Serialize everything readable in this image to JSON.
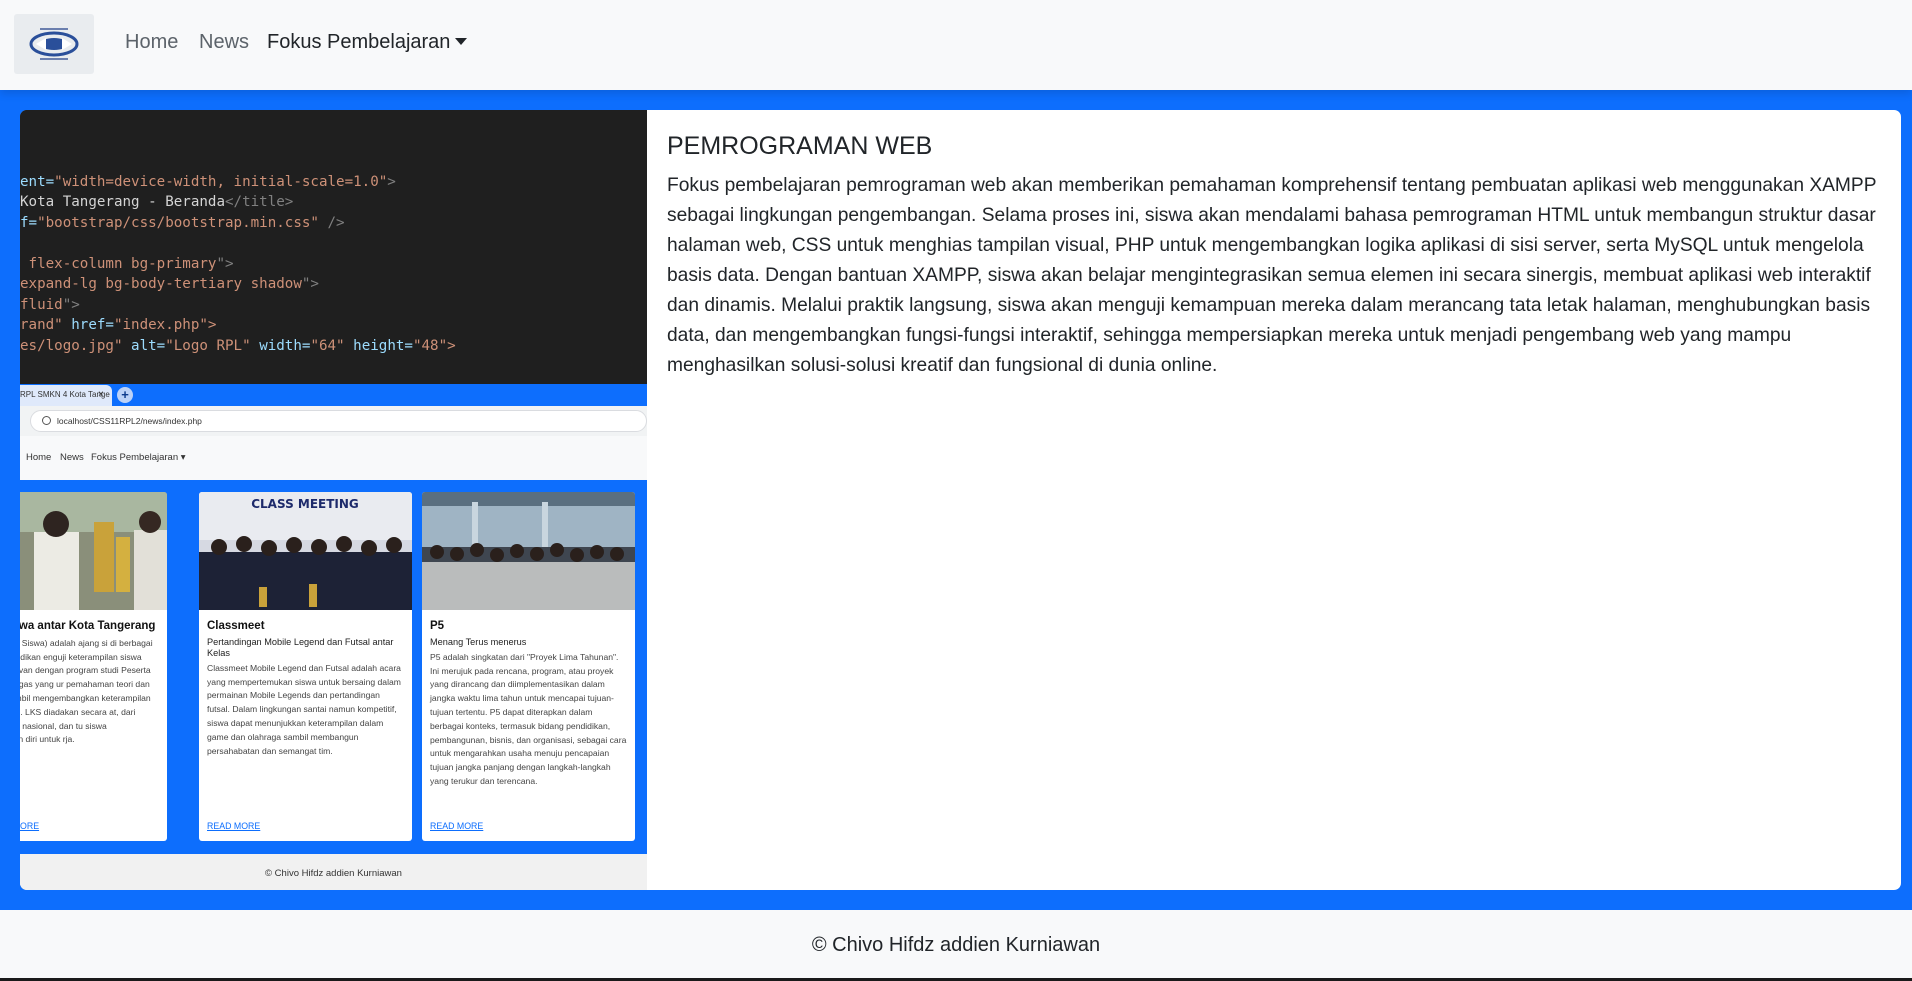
{
  "navbar": {
    "logo_alt": "Logo RPL",
    "links": [
      {
        "label": "Home"
      },
      {
        "label": "News"
      },
      {
        "label": "Fokus Pembelajaran"
      }
    ]
  },
  "main": {
    "card": {
      "title": "PEMROGRAMAN WEB",
      "text": "Fokus pembelajaran pemrograman web akan memberikan pemahaman komprehensif tentang pembuatan aplikasi web menggunakan XAMPP sebagai lingkungan pengembangan. Selama proses ini, siswa akan mendalami bahasa pemrograman HTML untuk membangun struktur dasar halaman web, CSS untuk menghias tampilan visual, PHP untuk mengembangkan logika aplikasi di sisi server, serta MySQL untuk mengelola basis data. Dengan bantuan XAMPP, siswa akan belajar mengintegrasikan semua elemen ini secara sinergis, membuat aplikasi web interaktif dan dinamis. Melalui praktik langsung, siswa akan menguji kemampuan mereka dalam merancang tata letak halaman, menghubungkan basis data, dan mengembangkan fungsi-fungsi interaktif, sehingga mempersiapkan mereka untuk menjadi pengembang web yang mampu menghasilkan solusi-solusi kreatif dan fungsional di dunia online."
    },
    "image": {
      "code_lines": [
        [
          "ent=",
          "\"width=device-width, initial-scale=1.0\"",
          ">"
        ],
        [
          "Kota Tangerang - Beranda",
          "</title>",
          ""
        ],
        [
          "f=",
          "\"bootstrap/css/bootstrap.min.css\"",
          " />"
        ],
        [
          "",
          "",
          ""
        ],
        [
          " flex-column bg-primary",
          "\">",
          ""
        ],
        [
          "expand-lg bg-body-tertiary shadow",
          "\">",
          ""
        ],
        [
          "fluid",
          "\">",
          ""
        ],
        [
          "rand\" ",
          "href=",
          "\"index.php\">"
        ],
        [
          "es/logo.jpg\" ",
          "alt=",
          "\"Logo RPL\" "
        ]
      ],
      "code_tail": [
        "width=",
        "\"64\" ",
        "height=",
        "\"48\">"
      ],
      "tab_label": "RPL SMKN 4 Kota Tange",
      "tab_close": "×",
      "new_tab": "+",
      "address": "localhost/CSS11RPL2/news/index.php",
      "mini_nav": [
        "Home",
        "News",
        "Fokus Pembelajaran ▾"
      ],
      "cards": [
        {
          "title": "Kreatif Siswa antar Kota Tangerang",
          "subtitle": "",
          "text": "ba Kompetensi Siswa) adalah ajang si di berbagai tingkatan pendidikan enguji keterampilan siswa dalam ang relevan dengan program studi Peserta menghadapi tugas yang ur pemahaman teori dan penerapan sambil mengembangkan keterampilan tif dan kerja tim. LKS diadakan secara at, dari sekolah hingga nasional, dan tu siswa mempersiapkan diri untuk rja.",
          "more": "ORE"
        },
        {
          "title": "Classmeet",
          "subtitle": "Pertandingan Mobile Legend dan Futsal antar Kelas",
          "text": "Classmeet Mobile Legend dan Futsal adalah acara yang mempertemukan siswa untuk bersaing dalam permainan Mobile Legends dan pertandingan futsal. Dalam lingkungan santai namun kompetitif, siswa dapat menunjukkan keterampilan dalam game dan olahraga sambil membangun persahabatan dan semangat tim.",
          "more": "READ MORE",
          "banner": "CLASS MEETING"
        },
        {
          "title": "P5",
          "subtitle": "Menang Terus menerus",
          "text": "P5 adalah singkatan dari \"Proyek Lima Tahunan\". Ini merujuk pada rencana, program, atau proyek yang dirancang dan diimplementasikan dalam jangka waktu lima tahun untuk mencapai tujuan-tujuan tertentu. P5 dapat diterapkan dalam berbagai konteks, termasuk bidang pendidikan, pembangunan, bisnis, dan organisasi, sebagai cara untuk mengarahkan usaha menuju pencapaian tujuan jangka panjang dengan langkah-langkah yang terukur dan terencana.",
          "more": "READ MORE"
        }
      ],
      "footer": "© Chivo Hifdz addien Kurniawan"
    }
  },
  "footer": {
    "text": "© Chivo Hifdz addien Kurniawan"
  },
  "colors": {
    "primary": "#0d6efd",
    "navbar_bg": "#f8f9fa",
    "editor_bg": "#1f1f1f"
  }
}
